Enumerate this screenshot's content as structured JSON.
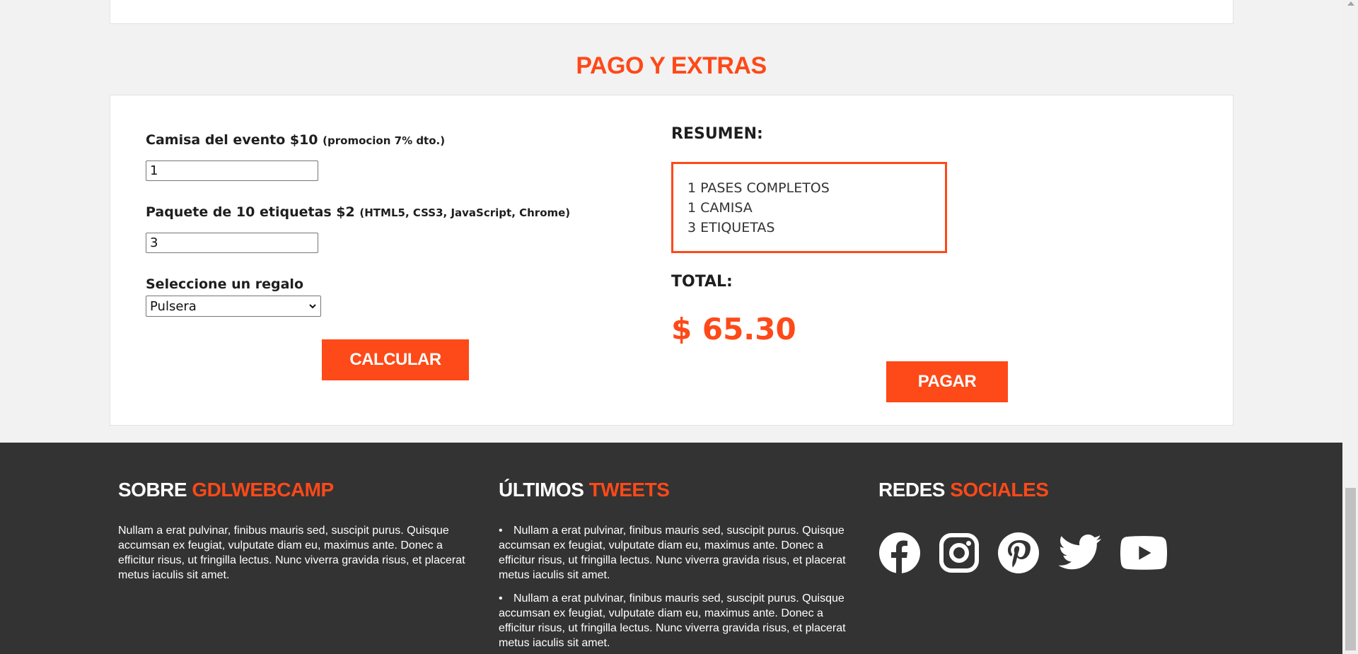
{
  "section": {
    "title": "PAGO Y EXTRAS"
  },
  "form": {
    "shirt": {
      "label": "Camisa del evento $10",
      "note": "(promocion 7% dto.)",
      "value": "1"
    },
    "stickers": {
      "label": "Paquete de 10 etiquetas $2",
      "note": "(HTML5, CSS3, JavaScript, Chrome)",
      "value": "3"
    },
    "gift": {
      "label": "Seleccione un regalo",
      "selected": "Pulsera"
    },
    "calc_button": "CALCULAR"
  },
  "summary": {
    "title": "RESUMEN:",
    "lines": [
      "1 PASES COMPLETOS",
      "1 CAMISA",
      "3 ETIQUETAS"
    ],
    "total_label": "TOTAL:",
    "total_value": "$ 65.30",
    "pay_button": "PAGAR"
  },
  "footer": {
    "about": {
      "title_plain": "SOBRE",
      "title_accent": "GDLWEBCAMP",
      "text": "Nullam a erat pulvinar, finibus mauris sed, suscipit purus. Quisque accumsan ex feugiat, vulputate diam eu, maximus ante. Donec a efficitur risus, ut fringilla lectus. Nunc viverra gravida risus, et placerat metus iaculis sit amet."
    },
    "tweets": {
      "title_plain": "ÚLTIMOS",
      "title_accent": "TWEETS",
      "items": [
        "Nullam a erat pulvinar, finibus mauris sed, suscipit purus. Quisque accumsan ex feugiat, vulputate diam eu, maximus ante. Donec a efficitur risus, ut fringilla lectus. Nunc viverra gravida risus, et placerat metus iaculis sit amet.",
        "Nullam a erat pulvinar, finibus mauris sed, suscipit purus. Quisque accumsan ex feugiat, vulputate diam eu, maximus ante. Donec a efficitur risus, ut fringilla lectus. Nunc viverra gravida risus, et placerat metus iaculis sit amet."
      ]
    },
    "social": {
      "title_plain": "REDES",
      "title_accent": "SOCIALES",
      "icons": [
        "facebook-icon",
        "instagram-icon",
        "pinterest-icon",
        "twitter-icon",
        "youtube-icon"
      ]
    }
  },
  "colors": {
    "accent": "#fe4918",
    "footer_bg": "#333333",
    "page_bg": "#f2f2f2"
  }
}
